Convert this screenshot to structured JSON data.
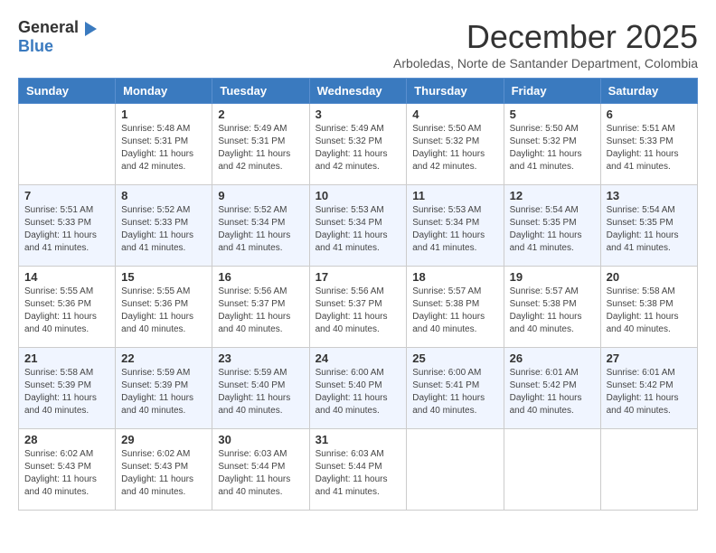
{
  "header": {
    "logo_general": "General",
    "logo_blue": "Blue",
    "month_title": "December 2025",
    "subtitle": "Arboledas, Norte de Santander Department, Colombia"
  },
  "weekdays": [
    "Sunday",
    "Monday",
    "Tuesday",
    "Wednesday",
    "Thursday",
    "Friday",
    "Saturday"
  ],
  "weeks": [
    [
      {
        "day": "",
        "sunrise": "",
        "sunset": "",
        "daylight": ""
      },
      {
        "day": "1",
        "sunrise": "Sunrise: 5:48 AM",
        "sunset": "Sunset: 5:31 PM",
        "daylight": "Daylight: 11 hours and 42 minutes."
      },
      {
        "day": "2",
        "sunrise": "Sunrise: 5:49 AM",
        "sunset": "Sunset: 5:31 PM",
        "daylight": "Daylight: 11 hours and 42 minutes."
      },
      {
        "day": "3",
        "sunrise": "Sunrise: 5:49 AM",
        "sunset": "Sunset: 5:32 PM",
        "daylight": "Daylight: 11 hours and 42 minutes."
      },
      {
        "day": "4",
        "sunrise": "Sunrise: 5:50 AM",
        "sunset": "Sunset: 5:32 PM",
        "daylight": "Daylight: 11 hours and 42 minutes."
      },
      {
        "day": "5",
        "sunrise": "Sunrise: 5:50 AM",
        "sunset": "Sunset: 5:32 PM",
        "daylight": "Daylight: 11 hours and 41 minutes."
      },
      {
        "day": "6",
        "sunrise": "Sunrise: 5:51 AM",
        "sunset": "Sunset: 5:33 PM",
        "daylight": "Daylight: 11 hours and 41 minutes."
      }
    ],
    [
      {
        "day": "7",
        "sunrise": "Sunrise: 5:51 AM",
        "sunset": "Sunset: 5:33 PM",
        "daylight": "Daylight: 11 hours and 41 minutes."
      },
      {
        "day": "8",
        "sunrise": "Sunrise: 5:52 AM",
        "sunset": "Sunset: 5:33 PM",
        "daylight": "Daylight: 11 hours and 41 minutes."
      },
      {
        "day": "9",
        "sunrise": "Sunrise: 5:52 AM",
        "sunset": "Sunset: 5:34 PM",
        "daylight": "Daylight: 11 hours and 41 minutes."
      },
      {
        "day": "10",
        "sunrise": "Sunrise: 5:53 AM",
        "sunset": "Sunset: 5:34 PM",
        "daylight": "Daylight: 11 hours and 41 minutes."
      },
      {
        "day": "11",
        "sunrise": "Sunrise: 5:53 AM",
        "sunset": "Sunset: 5:34 PM",
        "daylight": "Daylight: 11 hours and 41 minutes."
      },
      {
        "day": "12",
        "sunrise": "Sunrise: 5:54 AM",
        "sunset": "Sunset: 5:35 PM",
        "daylight": "Daylight: 11 hours and 41 minutes."
      },
      {
        "day": "13",
        "sunrise": "Sunrise: 5:54 AM",
        "sunset": "Sunset: 5:35 PM",
        "daylight": "Daylight: 11 hours and 41 minutes."
      }
    ],
    [
      {
        "day": "14",
        "sunrise": "Sunrise: 5:55 AM",
        "sunset": "Sunset: 5:36 PM",
        "daylight": "Daylight: 11 hours and 40 minutes."
      },
      {
        "day": "15",
        "sunrise": "Sunrise: 5:55 AM",
        "sunset": "Sunset: 5:36 PM",
        "daylight": "Daylight: 11 hours and 40 minutes."
      },
      {
        "day": "16",
        "sunrise": "Sunrise: 5:56 AM",
        "sunset": "Sunset: 5:37 PM",
        "daylight": "Daylight: 11 hours and 40 minutes."
      },
      {
        "day": "17",
        "sunrise": "Sunrise: 5:56 AM",
        "sunset": "Sunset: 5:37 PM",
        "daylight": "Daylight: 11 hours and 40 minutes."
      },
      {
        "day": "18",
        "sunrise": "Sunrise: 5:57 AM",
        "sunset": "Sunset: 5:38 PM",
        "daylight": "Daylight: 11 hours and 40 minutes."
      },
      {
        "day": "19",
        "sunrise": "Sunrise: 5:57 AM",
        "sunset": "Sunset: 5:38 PM",
        "daylight": "Daylight: 11 hours and 40 minutes."
      },
      {
        "day": "20",
        "sunrise": "Sunrise: 5:58 AM",
        "sunset": "Sunset: 5:38 PM",
        "daylight": "Daylight: 11 hours and 40 minutes."
      }
    ],
    [
      {
        "day": "21",
        "sunrise": "Sunrise: 5:58 AM",
        "sunset": "Sunset: 5:39 PM",
        "daylight": "Daylight: 11 hours and 40 minutes."
      },
      {
        "day": "22",
        "sunrise": "Sunrise: 5:59 AM",
        "sunset": "Sunset: 5:39 PM",
        "daylight": "Daylight: 11 hours and 40 minutes."
      },
      {
        "day": "23",
        "sunrise": "Sunrise: 5:59 AM",
        "sunset": "Sunset: 5:40 PM",
        "daylight": "Daylight: 11 hours and 40 minutes."
      },
      {
        "day": "24",
        "sunrise": "Sunrise: 6:00 AM",
        "sunset": "Sunset: 5:40 PM",
        "daylight": "Daylight: 11 hours and 40 minutes."
      },
      {
        "day": "25",
        "sunrise": "Sunrise: 6:00 AM",
        "sunset": "Sunset: 5:41 PM",
        "daylight": "Daylight: 11 hours and 40 minutes."
      },
      {
        "day": "26",
        "sunrise": "Sunrise: 6:01 AM",
        "sunset": "Sunset: 5:42 PM",
        "daylight": "Daylight: 11 hours and 40 minutes."
      },
      {
        "day": "27",
        "sunrise": "Sunrise: 6:01 AM",
        "sunset": "Sunset: 5:42 PM",
        "daylight": "Daylight: 11 hours and 40 minutes."
      }
    ],
    [
      {
        "day": "28",
        "sunrise": "Sunrise: 6:02 AM",
        "sunset": "Sunset: 5:43 PM",
        "daylight": "Daylight: 11 hours and 40 minutes."
      },
      {
        "day": "29",
        "sunrise": "Sunrise: 6:02 AM",
        "sunset": "Sunset: 5:43 PM",
        "daylight": "Daylight: 11 hours and 40 minutes."
      },
      {
        "day": "30",
        "sunrise": "Sunrise: 6:03 AM",
        "sunset": "Sunset: 5:44 PM",
        "daylight": "Daylight: 11 hours and 40 minutes."
      },
      {
        "day": "31",
        "sunrise": "Sunrise: 6:03 AM",
        "sunset": "Sunset: 5:44 PM",
        "daylight": "Daylight: 11 hours and 41 minutes."
      },
      {
        "day": "",
        "sunrise": "",
        "sunset": "",
        "daylight": ""
      },
      {
        "day": "",
        "sunrise": "",
        "sunset": "",
        "daylight": ""
      },
      {
        "day": "",
        "sunrise": "",
        "sunset": "",
        "daylight": ""
      }
    ]
  ]
}
